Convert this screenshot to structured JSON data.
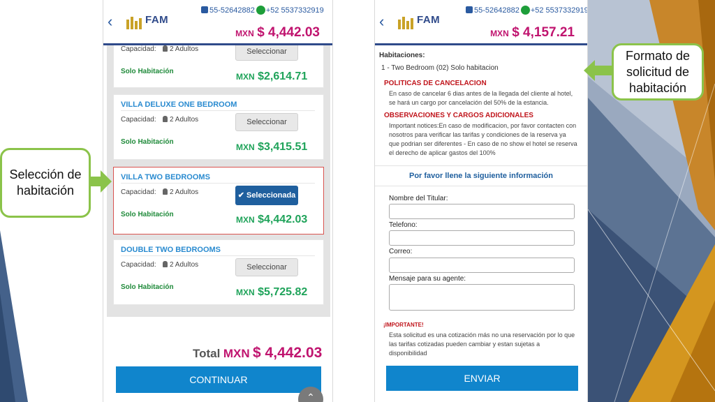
{
  "contacts": {
    "phone": "55-52642882",
    "whatsapp": "+52 5537332919"
  },
  "brand": {
    "logo_text": "FAM"
  },
  "colors": {
    "accent_blue": "#1085cc",
    "price_magenta": "#c0146f",
    "price_green": "#1fa35a",
    "callout_green": "#8bc34a",
    "selected_red": "#d9534f"
  },
  "left_phone": {
    "header_currency": "MXN",
    "header_amount": "$ 4,442.03",
    "top_partial": {
      "capacity": "Capacidad:",
      "adults": "2 Adultos",
      "button": "Seleccionar",
      "room_type": "Solo Habitación",
      "price_currency": "MXN",
      "price_amount": "$2,614.71"
    },
    "rooms": [
      {
        "name": "VILLA DELUXE ONE BEDROOM",
        "capacity": "Capacidad:",
        "adults": "2 Adultos",
        "button": "Seleccionar",
        "room_type": "Solo Habitación",
        "price_currency": "MXN",
        "price_amount": "$3,415.51"
      },
      {
        "name": "VILLA TWO BEDROOMS",
        "capacity": "Capacidad:",
        "adults": "2 Adultos",
        "button": "✔ Seleccionada",
        "room_type": "Solo Habitación",
        "price_currency": "MXN",
        "price_amount": "$4,442.03",
        "selected": true
      },
      {
        "name": "DOUBLE TWO BEDROOMS",
        "capacity": "Capacidad:",
        "adults": "2 Adultos",
        "button": "Seleccionar",
        "room_type": "Solo Habitación",
        "price_currency": "MXN",
        "price_amount": "$5,725.82"
      }
    ],
    "total_label": "Total",
    "total_currency": "MXN",
    "total_amount": "$ 4,442.03",
    "continue_button": "CONTINUAR",
    "scroll_up_icon": "chevron-up-icon"
  },
  "right_phone": {
    "header_currency": "MXN",
    "header_amount": "$ 4,157.21",
    "rooms_heading": "Habitaciones:",
    "room_line": "1 - Two Bedroom (02) Solo habitacion",
    "cancel_heading": "POLITICAS DE CANCELACION",
    "cancel_text": "En caso de cancelar 6 dias antes de la llegada del cliente al hotel, se hará un cargo por cancelación del 50% de la estancia.",
    "obs_heading": "OBSERVACIONES Y CARGOS ADICIONALES",
    "obs_text": "Important notices:En caso de modificacion, por favor contacten con nosotros para verificar las tarifas y condiciones de la reserva ya que podrian ser diferentes - En caso de no show el hotel se reserva el derecho de aplicar gastos del 100%",
    "form_title": "Por favor llene la siguiente información",
    "fields": {
      "holder": "Nombre del Titular:",
      "phone": "Telefono:",
      "email": "Correo:",
      "message": "Mensaje para su agente:"
    },
    "important_heading": "¡IMPORTANTE!",
    "important_text": "Esta solicitud es una cotización más no una reservación por lo que las tarifas cotizadas pueden cambiar y estan sujetas a disponibilidad",
    "send_button": "ENVIAR"
  },
  "callouts": {
    "left": "Selección de habitación",
    "right": "Formato de solicitud de habitación"
  }
}
